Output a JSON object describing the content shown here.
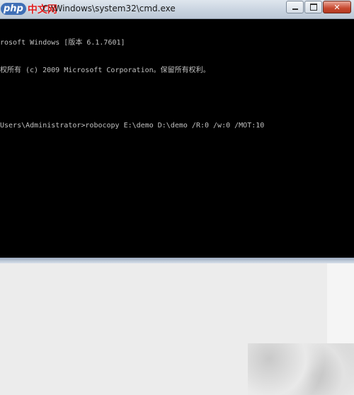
{
  "window": {
    "title": "C:\\Windows\\system32\\cmd.exe",
    "minimize_symbol": "",
    "maximize_symbol": "",
    "close_symbol": "✕"
  },
  "watermark": {
    "logo": "php",
    "text": "中文网"
  },
  "console": {
    "lines": [
      "rosoft Windows [版本 6.1.7601]",
      "权所有 (c) 2009 Microsoft Corporation。保留所有权利。",
      "",
      "Users\\Administrator>robocopy E:\\demo D:\\demo /R:0 /w:0 /MOT:10"
    ]
  },
  "colors": {
    "console_bg": "#000000",
    "console_fg": "#c0c0c0",
    "close_button": "#c8492f",
    "titlebar": "#c9d4e0"
  }
}
